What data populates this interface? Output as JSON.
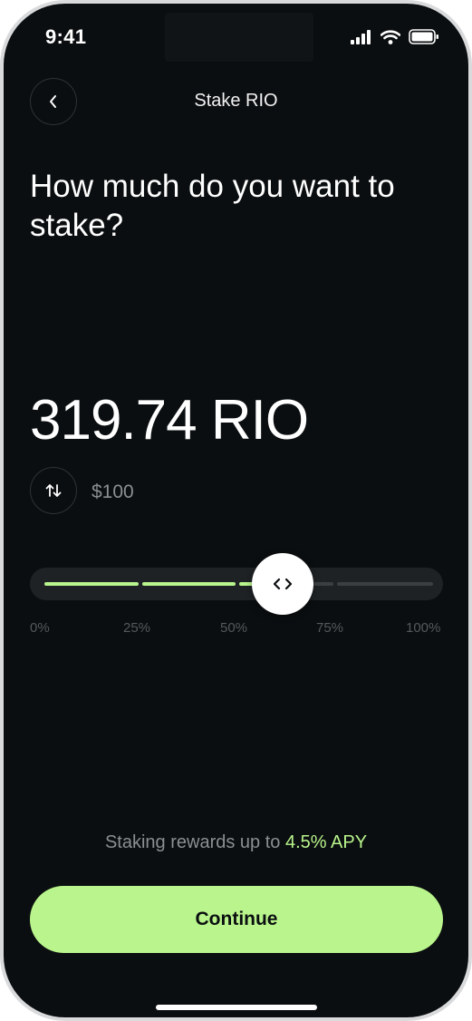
{
  "status_bar": {
    "time": "9:41",
    "icons": [
      "signal-icon",
      "wifi-icon",
      "battery-icon"
    ]
  },
  "header": {
    "title": "Stake RIO",
    "back_icon": "chevron-left-icon"
  },
  "question": "How much do you want to stake?",
  "amount": {
    "value": "319.74 RIO",
    "fiat": "$100",
    "swap_icon": "swap-vertical-icon"
  },
  "slider": {
    "value_fraction": 0.6,
    "ticks": [
      "0%",
      "25%",
      "50%",
      "75%",
      "100%"
    ],
    "handle_icon": "code-arrows-icon"
  },
  "rewards": {
    "prefix": "Staking rewards up to ",
    "highlight": "4.5% APY"
  },
  "cta": {
    "label": "Continue"
  },
  "colors": {
    "background": "#0b0e10",
    "accent": "#b9f58c",
    "muted_text": "#8b8f92",
    "track": "#1e2225",
    "inactive_segment": "#3b3f42"
  }
}
